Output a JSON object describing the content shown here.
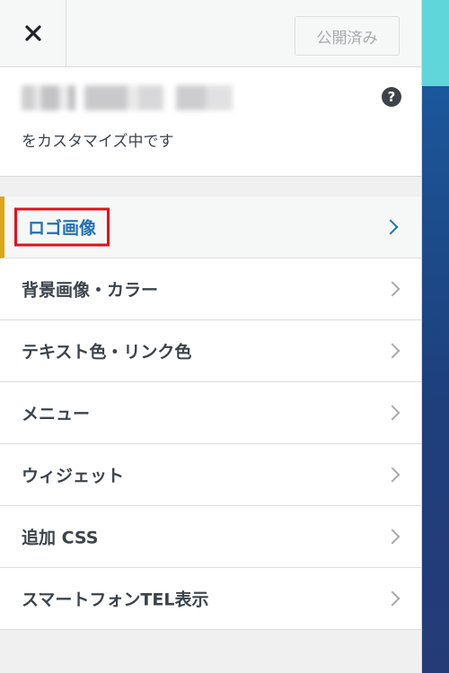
{
  "header": {
    "close_symbol": "✕",
    "publish_label": "公開済み"
  },
  "info": {
    "subtitle": "をカスタマイズ中です",
    "help_symbol": "?"
  },
  "menu": {
    "items": [
      {
        "label": "ロゴ画像",
        "active": true
      },
      {
        "label": "背景画像・カラー"
      },
      {
        "label": "テキスト色・リンク色"
      },
      {
        "label": "メニュー"
      },
      {
        "label": "ウィジェット"
      },
      {
        "label": "追加 CSS"
      },
      {
        "label": "スマートフォンTEL表示"
      }
    ]
  },
  "colors": {
    "accent_blue": "#2271b1",
    "active_border": "#dba617",
    "highlight_red": "#e1111c"
  }
}
